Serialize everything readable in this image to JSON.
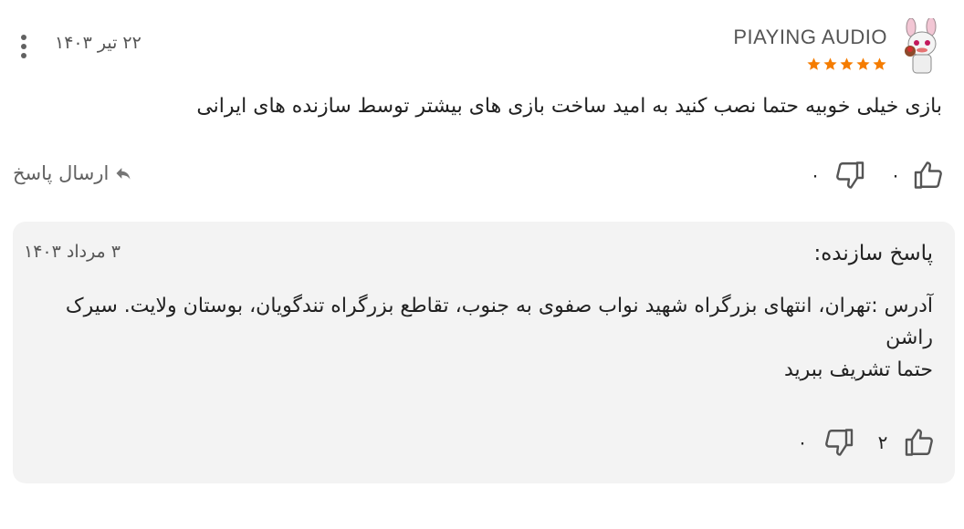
{
  "review": {
    "author": "PIAYING AUDIO",
    "rating": 5,
    "date": "۲۲ تیر ۱۴۰۳",
    "text": "بازی خیلی خوبیه حتما نصب کنید به امید ساخت بازی های بیشتر توسط سازنده های ایرانی",
    "likes": "۰",
    "dislikes": "۰",
    "reply_label": "ارسال پاسخ"
  },
  "developer_reply": {
    "title": "پاسخ سازنده:",
    "date": "۳ مرداد ۱۴۰۳",
    "lines": [
      "آدرس :تهران، انتهای بزرگراه شهید نواب صفوی به جنوب، تقاطع بزرگراه تندگویان، بوستان ولایت. سیرک راشن",
      "حتما تشریف ببرید"
    ],
    "likes": "۲",
    "dislikes": "۰"
  },
  "colors": {
    "star": "#f57c00",
    "card_background": "#f3f3f3",
    "icon": "#555555",
    "text": "#212121"
  },
  "icons": {
    "more": "more-vertical-icon",
    "like": "thumb-up-icon",
    "dislike": "thumb-down-icon",
    "reply": "reply-arrow-icon"
  }
}
